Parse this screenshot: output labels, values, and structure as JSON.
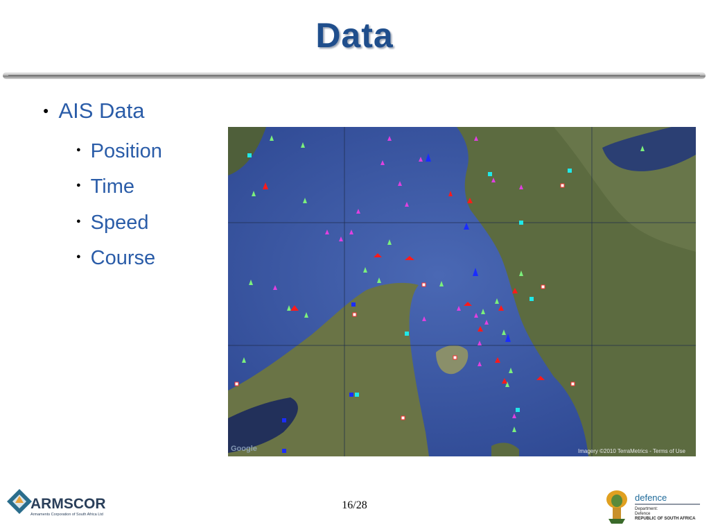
{
  "slide": {
    "title": "Data",
    "page_number": "16/28"
  },
  "bullets": {
    "main": "AIS Data",
    "sub": [
      "Position",
      "Time",
      "Speed",
      "Course"
    ]
  },
  "map": {
    "attribution": "Imagery ©2010 TerraMetrics - Terms of Use",
    "google_logo": "Google"
  },
  "footer": {
    "armscor_name": "ARMSCOR",
    "armscor_tagline": "Armaments Corporation of South Africa Ltd",
    "defence_name": "defence",
    "defence_dept": "Department:",
    "defence_sub": "Defence",
    "defence_country": "REPUBLIC OF SOUTH AFRICA"
  },
  "colors": {
    "title": "#1f4e8c",
    "bullet_text": "#2a5ca8",
    "sea": "#3a5aa8",
    "land": "#5a6e3e"
  }
}
